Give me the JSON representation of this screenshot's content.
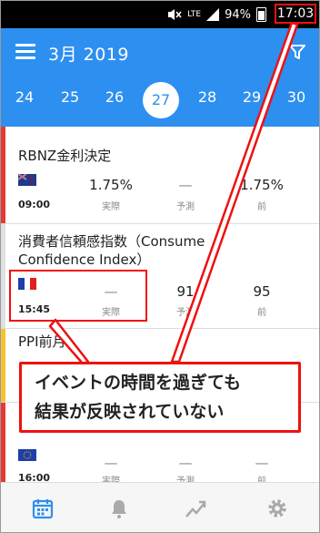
{
  "status": {
    "lte": "LTE",
    "battery": "94%",
    "time": "17:03"
  },
  "header": {
    "month": "3月 2019"
  },
  "dates": [
    "24",
    "25",
    "26",
    "27",
    "28",
    "29",
    "30"
  ],
  "selected_date": "27",
  "events": [
    {
      "title": "RBNZ金利決定",
      "time": "09:00",
      "country": "NZ",
      "actual": "1.75%",
      "forecast": "—",
      "previous": "1.75%"
    },
    {
      "title": "消費者信頼感指数（Consumer Confidence Index）",
      "title_line1": "消費者信頼感指数（Consume",
      "title_line2": "Confidence Index）",
      "time": "15:45",
      "country": "FR",
      "actual": "—",
      "forecast": "91",
      "previous": "95"
    },
    {
      "title": "PPI前月比",
      "title_visible": "PPI前月"
    },
    {
      "time": "16:00",
      "country": "EU",
      "actual": "—",
      "forecast": "—",
      "previous": "—"
    }
  ],
  "labels": {
    "actual": "実際",
    "forecast": "予測",
    "previous": "前"
  },
  "annotation": {
    "line1": "イベントの時間を過ぎても",
    "line2": "結果が反映されていない"
  },
  "colors": {
    "primary": "#2d8ff0",
    "highlight": "#e11111",
    "impact_high": "#e53935",
    "impact_mid": "#f4c430"
  },
  "nav": [
    "calendar-icon",
    "bell-icon",
    "chart-trend-icon",
    "settings-icon"
  ]
}
